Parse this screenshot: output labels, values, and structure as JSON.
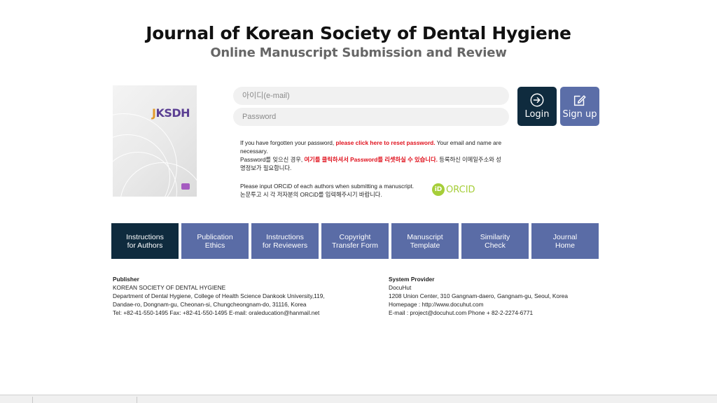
{
  "header": {
    "title": "Journal of Korean Society of Dental Hygiene",
    "subtitle": "Online Manuscript Submission and Review"
  },
  "cover": {
    "logo_j": "J",
    "logo_rest": "KSDH",
    "colors": {
      "accent_orange": "#e39b2b",
      "accent_purple": "#5b3f93"
    }
  },
  "login": {
    "id_placeholder": "아이디(e-mail)",
    "pw_placeholder": "Password",
    "login_label": "Login",
    "signup_label": "Sign up",
    "login_icon": "login-arrow-icon",
    "signup_icon": "edit-pencil-icon"
  },
  "notice": {
    "forgot_en_1": "If you have forgotten your password, ",
    "forgot_en_link": "please click here to reset password.",
    "forgot_en_2": " Your email and name are necessary.",
    "forgot_kr_1": "Password를 잊으신 경우, ",
    "forgot_kr_link": "여기를 클릭하셔서 Password를 리셋하실 수 있습니다.",
    "forgot_kr_2": " 등록하신 이메일주소와 성명정보가 필요합니다.",
    "orcid_en": "Please input ORCiD of each authors when submitting a manuscript.",
    "orcid_kr": "논문투고 시 각 저자분의 ORCiD를 입력해주시기 바랍니다.",
    "orcid_logo_id": "iD",
    "orcid_logo_text": "ORCID"
  },
  "nav": {
    "items": [
      {
        "label": "Instructions\nfor Authors",
        "active": true
      },
      {
        "label": "Publication\nEthics",
        "active": false
      },
      {
        "label": "Instructions\nfor Reviewers",
        "active": false
      },
      {
        "label": "Copyright\nTransfer Form",
        "active": false
      },
      {
        "label": "Manuscript\nTemplate",
        "active": false
      },
      {
        "label": "Similarity\nCheck",
        "active": false
      },
      {
        "label": "Journal\nHome",
        "active": false
      }
    ],
    "colors": {
      "default": "#5a6ca6",
      "active": "#0f2b3e"
    }
  },
  "footer": {
    "publisher": {
      "heading": "Publisher",
      "lines": [
        "KOREAN SOCIETY OF DENTAL HYGIENE",
        "Department of Dental Hygiene, College of Health Science Dankook University,119,",
        "Dandae-ro, Dongnam-gu, Cheonan-si, Chungcheongnam-do, 31116, Korea",
        "Tel: +82-41-550-1495  Fax: +82-41-550-1495  E-mail: oraleducation@hanmail.net"
      ]
    },
    "provider": {
      "heading": "System Provider",
      "lines": [
        "DocuHut",
        "1208 Union Center, 310 Gangnam-daero, Gangnam-gu, Seoul, Korea",
        "Homepage : http://www.docuhut.com",
        "E-mail : project@docuhut.com  Phone + 82-2-2274-6771"
      ]
    }
  }
}
